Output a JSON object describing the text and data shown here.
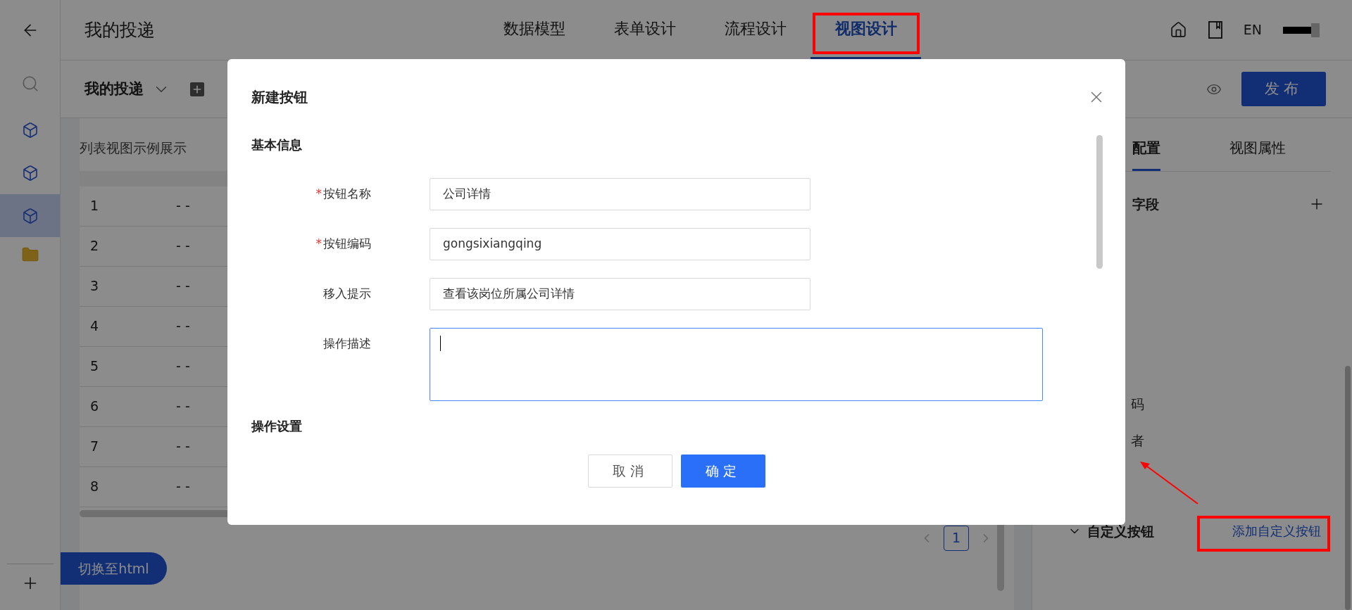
{
  "sidebar": {
    "items": [
      {
        "selected": false
      },
      {
        "selected": false
      },
      {
        "selected": true
      }
    ]
  },
  "header": {
    "title": "我的投递",
    "nav_tabs": [
      {
        "label": "数据模型",
        "selected": false
      },
      {
        "label": "表单设计",
        "selected": false
      },
      {
        "label": "流程设计",
        "selected": false
      },
      {
        "label": "视图设计",
        "selected": true
      }
    ],
    "language": "EN"
  },
  "toolbar": {
    "view_name": "我的投递",
    "publish_button": "发布"
  },
  "preview": {
    "caption": "列表视图示例展示",
    "rows": [
      {
        "index": "1",
        "column_2": "- -"
      },
      {
        "index": "2",
        "column_2": "- -"
      },
      {
        "index": "3",
        "column_2": "- -"
      },
      {
        "index": "4",
        "column_2": "- -"
      },
      {
        "index": "5",
        "column_2": "- -"
      },
      {
        "index": "6",
        "column_2": "- -"
      },
      {
        "index": "7",
        "column_2": "- -"
      },
      {
        "index": "8",
        "column_2": "- -"
      }
    ],
    "pagination": [
      {
        "label": "1",
        "selected": true
      }
    ],
    "switch_button": "切换至html"
  },
  "right_panel": {
    "tabs": [
      {
        "label": "配置",
        "selected": true
      },
      {
        "label": "视图属性",
        "selected": false
      }
    ],
    "section_title": "字段",
    "fragments": [
      "码",
      "者"
    ],
    "custom_buttons": {
      "title": "自定义按钮",
      "expanded": true,
      "add_link": "添加自定义按钮"
    }
  },
  "dialog": {
    "title": "新建按钮",
    "sections": [
      {
        "title": "基本信息",
        "fields": [
          {
            "kind": "input",
            "marker": "*",
            "label": "按钮名称",
            "value": "公司详情",
            "focused": false
          },
          {
            "kind": "input",
            "marker": "*",
            "label": "按钮编码",
            "value": "gongsixiangqing",
            "focused": false
          },
          {
            "kind": "input",
            "label": "移入提示",
            "value": "查看该岗位所属公司详情",
            "focused": false
          },
          {
            "kind": "textarea",
            "label": "操作描述",
            "focused": true
          }
        ]
      },
      {
        "title": "操作设置"
      }
    ],
    "cancel_button": "取消",
    "confirm_button": "确定"
  }
}
